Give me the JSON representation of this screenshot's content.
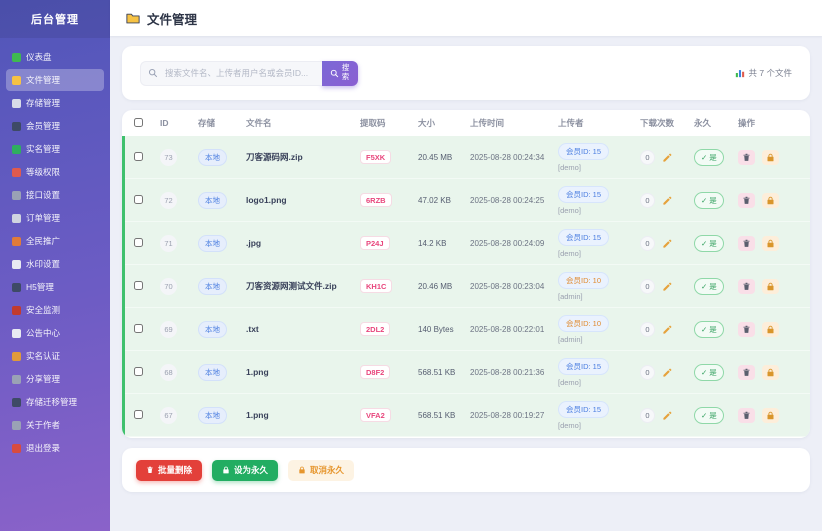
{
  "sidebar": {
    "title": "后台管理",
    "items": [
      {
        "label": "仪表盘",
        "icon": "dashboard-icon",
        "color": "#3fb950",
        "active": false
      },
      {
        "label": "文件管理",
        "icon": "folder-icon",
        "color": "#f6c244",
        "active": true
      },
      {
        "label": "存储管理",
        "icon": "storage-icon",
        "color": "#d8dce8",
        "active": false
      },
      {
        "label": "会员管理",
        "icon": "members-icon",
        "color": "#3e4a66",
        "active": false
      },
      {
        "label": "实名管理",
        "icon": "realname-icon",
        "color": "#2fae5f",
        "active": false
      },
      {
        "label": "等级权限",
        "icon": "level-icon",
        "color": "#e05a4e",
        "active": false
      },
      {
        "label": "接口设置",
        "icon": "api-icon",
        "color": "#9aa2b5",
        "active": false
      },
      {
        "label": "订单管理",
        "icon": "orders-icon",
        "color": "#cfd4e0",
        "active": false
      },
      {
        "label": "全民推广",
        "icon": "promotion-icon",
        "color": "#e07b3a",
        "active": false
      },
      {
        "label": "水印设置",
        "icon": "watermark-icon",
        "color": "#e8eaf2",
        "active": false
      },
      {
        "label": "H5管理",
        "icon": "h5-icon",
        "color": "#3e4a66",
        "active": false
      },
      {
        "label": "安全监测",
        "icon": "security-icon",
        "color": "#c23b2e",
        "active": false
      },
      {
        "label": "公告中心",
        "icon": "notice-icon",
        "color": "#e8eaf2",
        "active": false
      },
      {
        "label": "实名认证",
        "icon": "idcard-icon",
        "color": "#e09a3a",
        "active": false
      },
      {
        "label": "分享管理",
        "icon": "share-icon",
        "color": "#9aa2b5",
        "active": false
      },
      {
        "label": "存储迁移管理",
        "icon": "migration-icon",
        "color": "#3e4a66",
        "active": false
      },
      {
        "label": "关于作者",
        "icon": "author-icon",
        "color": "#9aa2b5",
        "active": false
      },
      {
        "label": "退出登录",
        "icon": "logout-icon",
        "color": "#d84b3f",
        "active": false
      }
    ]
  },
  "header": {
    "title": "文件管理"
  },
  "search": {
    "placeholder": "搜索文件名、上传者用户名或会员ID...",
    "button_label": "搜索",
    "file_count": "共 7 个文件"
  },
  "table": {
    "headers": [
      "ID",
      "存储",
      "文件名",
      "提取码",
      "大小",
      "上传时间",
      "上传者",
      "下载次数",
      "永久",
      "操作"
    ],
    "rows": [
      {
        "id": "73",
        "storage": "本地",
        "filename": "刀客源码网.zip",
        "code": "F5XK",
        "size": "20.45 MB",
        "time": "2025-08-28 00:24:34",
        "uploader": "会员ID: 15",
        "uploader_sub": "[demo]",
        "downloads": "0",
        "permanent": "是",
        "vip": false
      },
      {
        "id": "72",
        "storage": "本地",
        "filename": "logo1.png",
        "code": "6RZB",
        "size": "47.02 KB",
        "time": "2025-08-28 00:24:25",
        "uploader": "会员ID: 15",
        "uploader_sub": "[demo]",
        "downloads": "0",
        "permanent": "是",
        "vip": false
      },
      {
        "id": "71",
        "storage": "本地",
        "filename": ".jpg",
        "code": "P24J",
        "size": "14.2 KB",
        "time": "2025-08-28 00:24:09",
        "uploader": "会员ID: 15",
        "uploader_sub": "[demo]",
        "downloads": "0",
        "permanent": "是",
        "vip": false
      },
      {
        "id": "70",
        "storage": "本地",
        "filename": "刀客资源网测试文件.zip",
        "code": "KH1C",
        "size": "20.46 MB",
        "time": "2025-08-28 00:23:04",
        "uploader": "会员ID: 10",
        "uploader_sub": "[admin]",
        "downloads": "0",
        "permanent": "是",
        "vip": true
      },
      {
        "id": "69",
        "storage": "本地",
        "filename": ".txt",
        "code": "2DL2",
        "size": "140 Bytes",
        "time": "2025-08-28 00:22:01",
        "uploader": "会员ID: 10",
        "uploader_sub": "[admin]",
        "downloads": "0",
        "permanent": "是",
        "vip": true
      },
      {
        "id": "68",
        "storage": "本地",
        "filename": "1.png",
        "code": "D8F2",
        "size": "568.51 KB",
        "time": "2025-08-28 00:21:36",
        "uploader": "会员ID: 15",
        "uploader_sub": "[demo]",
        "downloads": "0",
        "permanent": "是",
        "vip": false
      },
      {
        "id": "67",
        "storage": "本地",
        "filename": "1.png",
        "code": "VFA2",
        "size": "568.51 KB",
        "time": "2025-08-28 00:19:27",
        "uploader": "会员ID: 15",
        "uploader_sub": "[demo]",
        "downloads": "0",
        "permanent": "是",
        "vip": false
      }
    ]
  },
  "footer": {
    "batch_delete": "批量删除",
    "set_permanent": "设为永久",
    "cancel_permanent": "取消永久"
  }
}
